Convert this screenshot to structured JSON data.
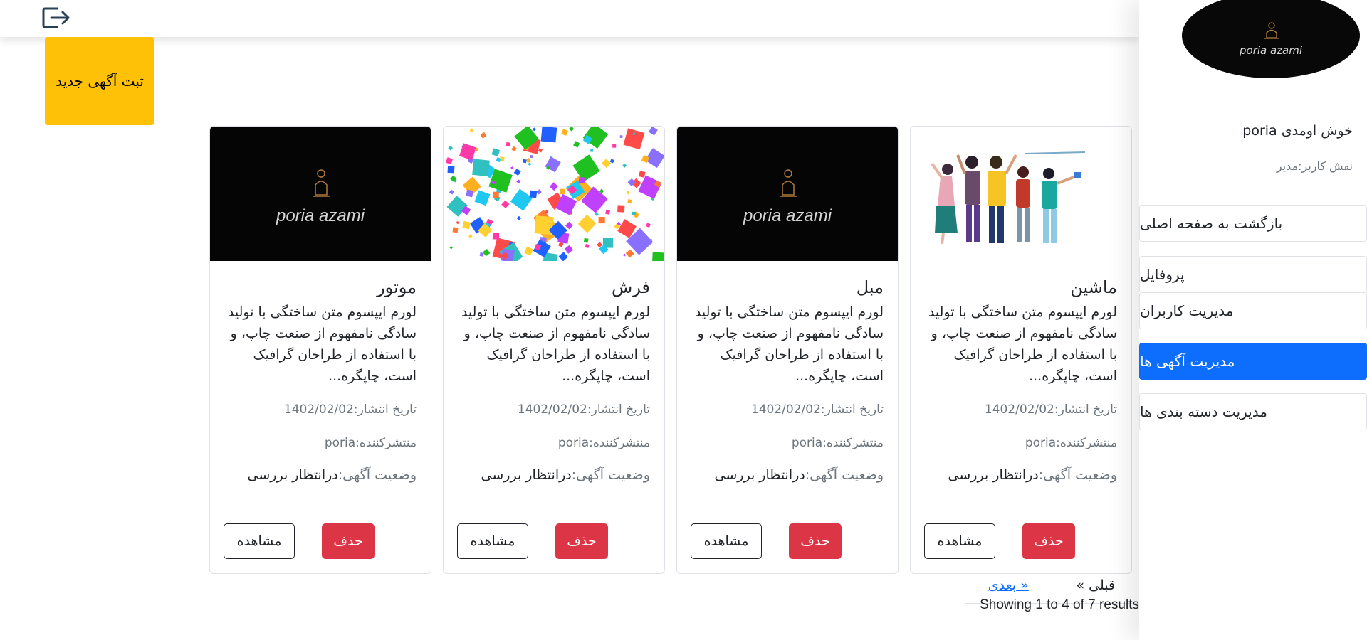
{
  "topbar": {
    "logout_icon": "logout-icon"
  },
  "new_ad_button": "ثبت آگهی جدید",
  "sidebar": {
    "brand": "poria azami",
    "welcome": "خوش اومدی poria",
    "role": "نقش کاربر:مدیر",
    "items": [
      {
        "label": "بازگشت به صفحه اصلی",
        "active": false
      },
      {
        "label": "پروفایل",
        "active": false
      },
      {
        "label": "مدیریت کاربران",
        "active": false
      },
      {
        "label": "مدیریت آگهی ها",
        "active": true
      },
      {
        "label": "مدیریت دسته بندی ها",
        "active": false
      }
    ]
  },
  "cards": [
    {
      "image": "people-illustration",
      "title": "ماشین",
      "text": "لورم ایپسوم متن ساختگی با تولید سادگی نامفهوم از صنعت چاپ، و با استفاده از طراحان گرافیک است، چاپگره...",
      "date": "تاریخ انتشار:1402/02/02",
      "publisher": "منتشرکننده:poria",
      "status_label": "وضعیت آگهی:",
      "status_value": "درانتظار بررسی",
      "delete_label": "حذف",
      "view_label": "مشاهده"
    },
    {
      "image": "brand-logo",
      "brand": "poria azami",
      "title": "مبل",
      "text": "لورم ایپسوم متن ساختگی با تولید سادگی نامفهوم از صنعت چاپ، و با استفاده از طراحان گرافیک است، چاپگره...",
      "date": "تاریخ انتشار:1402/02/02",
      "publisher": "منتشرکننده:poria",
      "status_label": "وضعیت آگهی:",
      "status_value": "درانتظار بررسی",
      "delete_label": "حذف",
      "view_label": "مشاهده"
    },
    {
      "image": "confetti",
      "title": "فرش",
      "text": "لورم ایپسوم متن ساختگی با تولید سادگی نامفهوم از صنعت چاپ، و با استفاده از طراحان گرافیک است، چاپگره...",
      "date": "تاریخ انتشار:1402/02/02",
      "publisher": "منتشرکننده:poria",
      "status_label": "وضعیت آگهی:",
      "status_value": "درانتظار بررسی",
      "delete_label": "حذف",
      "view_label": "مشاهده"
    },
    {
      "image": "brand-logo",
      "brand": "poria azami",
      "title": "موتور",
      "text": "لورم ایپسوم متن ساختگی با تولید سادگی نامفهوم از صنعت چاپ، و با استفاده از طراحان گرافیک است، چاپگره...",
      "date": "تاریخ انتشار:1402/02/02",
      "publisher": "منتشرکننده:poria",
      "status_label": "وضعیت آگهی:",
      "status_value": "درانتظار بررسی",
      "delete_label": "حذف",
      "view_label": "مشاهده"
    }
  ],
  "pagination": {
    "prev_label": "« قبلی",
    "next_label": "بعدی »",
    "results_text": "Showing 1 to 4 of 7 results"
  },
  "colors": {
    "accent_yellow": "#ffc107",
    "active_blue": "#0d6efd",
    "danger_red": "#dc3545"
  }
}
